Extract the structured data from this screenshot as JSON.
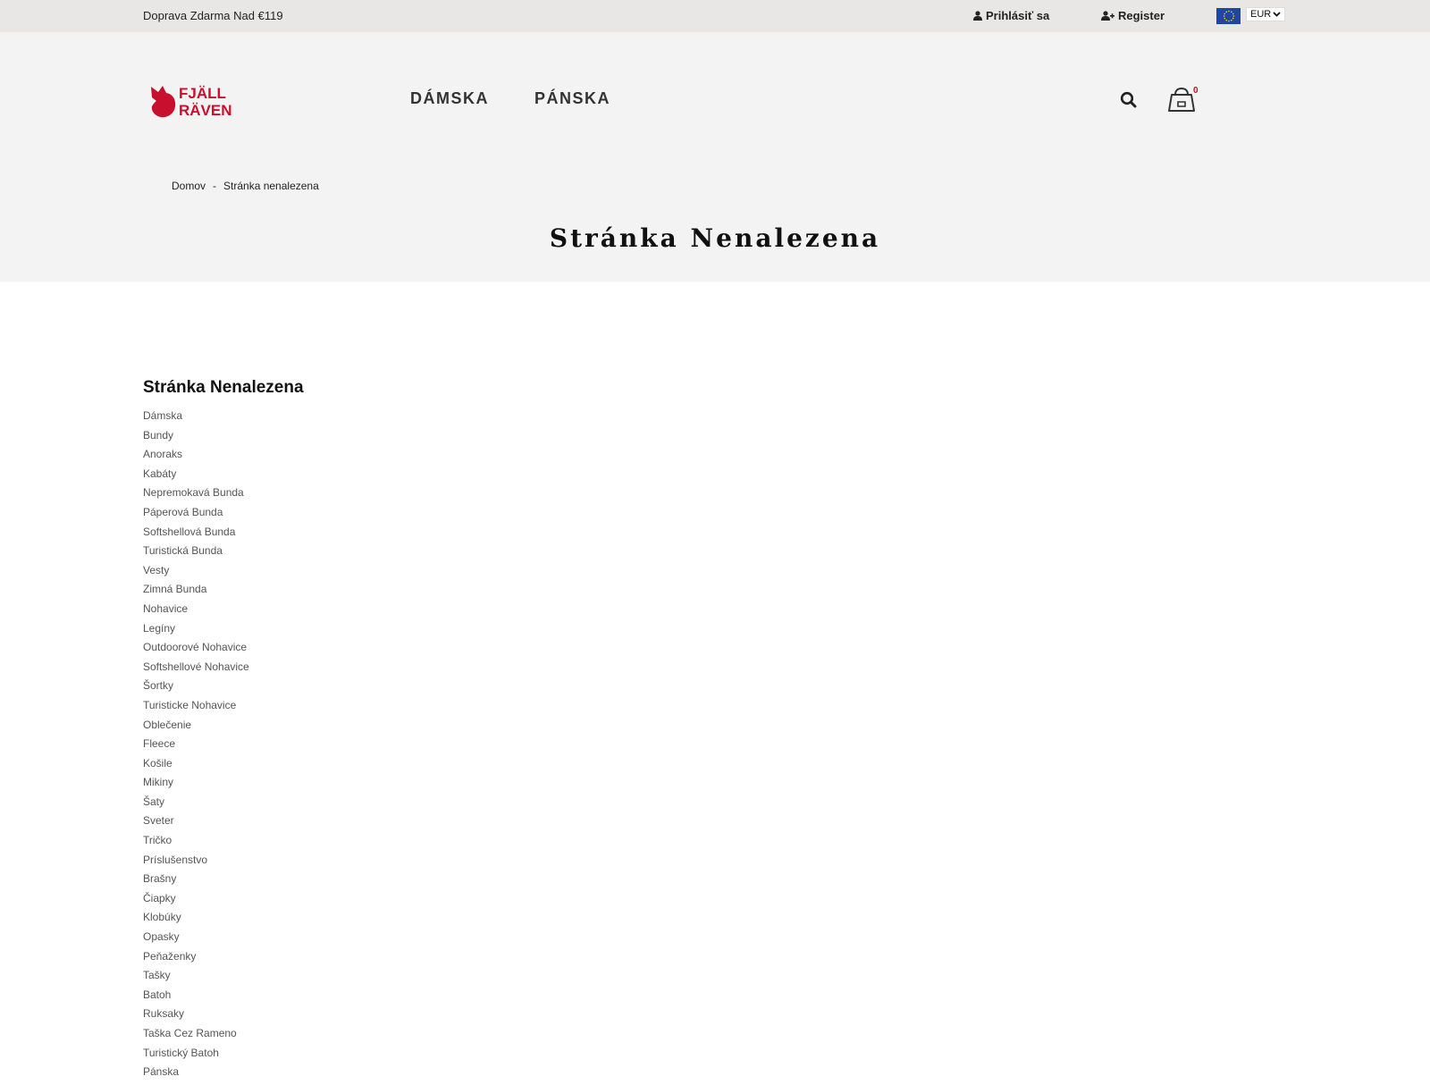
{
  "topbar": {
    "promo": "Doprava Zdarma Nad €119",
    "login_label": "Prihlásiť sa",
    "register_label": "Register",
    "currency": "EUR"
  },
  "header": {
    "logo_alt": "FJÄLL RÄVEN",
    "nav": [
      "DÁMSKA",
      "PÁNSKA"
    ],
    "cart_count": "0"
  },
  "breadcrumb": {
    "home": "Domov",
    "separator": "-",
    "current": "Stránka nenalezena"
  },
  "page_title": "Stránka Nenalezena",
  "main": {
    "section_title": "Stránka Nenalezena",
    "categories": [
      "Dámska",
      "Bundy",
      "Anoraks",
      "Kabáty",
      "Nepremokavá Bunda",
      "Páperová Bunda",
      "Softshellová Bunda",
      "Turistická Bunda",
      "Vesty",
      "Zimná Bunda",
      "Nohavice",
      "Legíny",
      "Outdoorové Nohavice",
      "Softshellové Nohavice",
      "Šortky",
      "Turisticke Nohavice",
      "Oblečenie",
      "Fleece",
      "Košile",
      "Mikiny",
      "Šaty",
      "Sveter",
      "Tričko",
      "Príslušenstvo",
      "Brašny",
      "Čiapky",
      "Klobúky",
      "Opasky",
      "Peňaženky",
      "Tašky",
      "Batoh",
      "Ruksaky",
      "Taška Cez Rameno",
      "Turistický Batoh",
      "Pánska"
    ]
  },
  "colors": {
    "brand_red": "#c8102e",
    "topbar_bg": "#e8e7e6",
    "header_bg": "#f3f3f3"
  },
  "icons": [
    "user-icon",
    "user-plus-icon",
    "eu-flag-icon",
    "search-icon",
    "cart-icon"
  ]
}
